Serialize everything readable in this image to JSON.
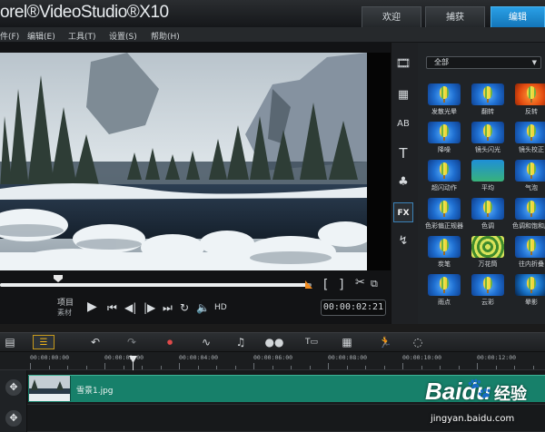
{
  "app": {
    "title": "orel®VideoStudio®X10",
    "tabs": [
      {
        "label": "欢迎"
      },
      {
        "label": "捕获"
      },
      {
        "label": "编辑"
      }
    ]
  },
  "menu": {
    "items": [
      "件(F)",
      "编辑(E)",
      "工具(T)",
      "设置(S)",
      "帮助(H)"
    ]
  },
  "player": {
    "mode_project": "项目",
    "mode_clip": "素材",
    "hd_label": "HD",
    "timecode": "00:00:02:21"
  },
  "library": {
    "dropdown_value": "全部",
    "effects": [
      {
        "label": "发散光晕",
        "icon": "balloon-icon"
      },
      {
        "label": "翻转",
        "icon": "balloon-icon"
      },
      {
        "label": "反转",
        "icon": "balloon-icon"
      },
      {
        "label": "降噪",
        "icon": "balloon-icon"
      },
      {
        "label": "镜头闪光",
        "icon": "balloon-icon"
      },
      {
        "label": "镜头校正",
        "icon": "balloon-icon"
      },
      {
        "label": "超闪动作",
        "icon": "balloon-icon"
      },
      {
        "label": "平均",
        "icon": "blur-icon"
      },
      {
        "label": "气泡",
        "icon": "balloon-icon"
      },
      {
        "label": "色彩偏正规器",
        "icon": "balloon-icon"
      },
      {
        "label": "色调",
        "icon": "balloon-icon"
      },
      {
        "label": "色调和饱和度",
        "icon": "balloon-icon"
      },
      {
        "label": "炭笔",
        "icon": "balloon-icon"
      },
      {
        "label": "万花筒",
        "icon": "kaleidoscope-icon"
      },
      {
        "label": "往内折叠",
        "icon": "balloon-icon"
      },
      {
        "label": "雨点",
        "icon": "balloon-icon"
      },
      {
        "label": "云彩",
        "icon": "balloon-icon"
      },
      {
        "label": "晕影",
        "icon": "balloon-icon"
      }
    ]
  },
  "timeline": {
    "ruler_labels": [
      "00:00:00:00",
      "00:00:02:00",
      "00:00:04:00",
      "00:00:06:00",
      "00:00:08:00",
      "00:00:10:00",
      "00:00:12:00"
    ],
    "clip_name": "雪景1.jpg"
  },
  "watermark": {
    "brand": "Baidu",
    "brand_suffix": "经验",
    "url": "jingyan.baidu.com"
  },
  "colors": {
    "accent": "#1a8fd6",
    "clip": "#17806a",
    "trim": "#f08a1e"
  }
}
